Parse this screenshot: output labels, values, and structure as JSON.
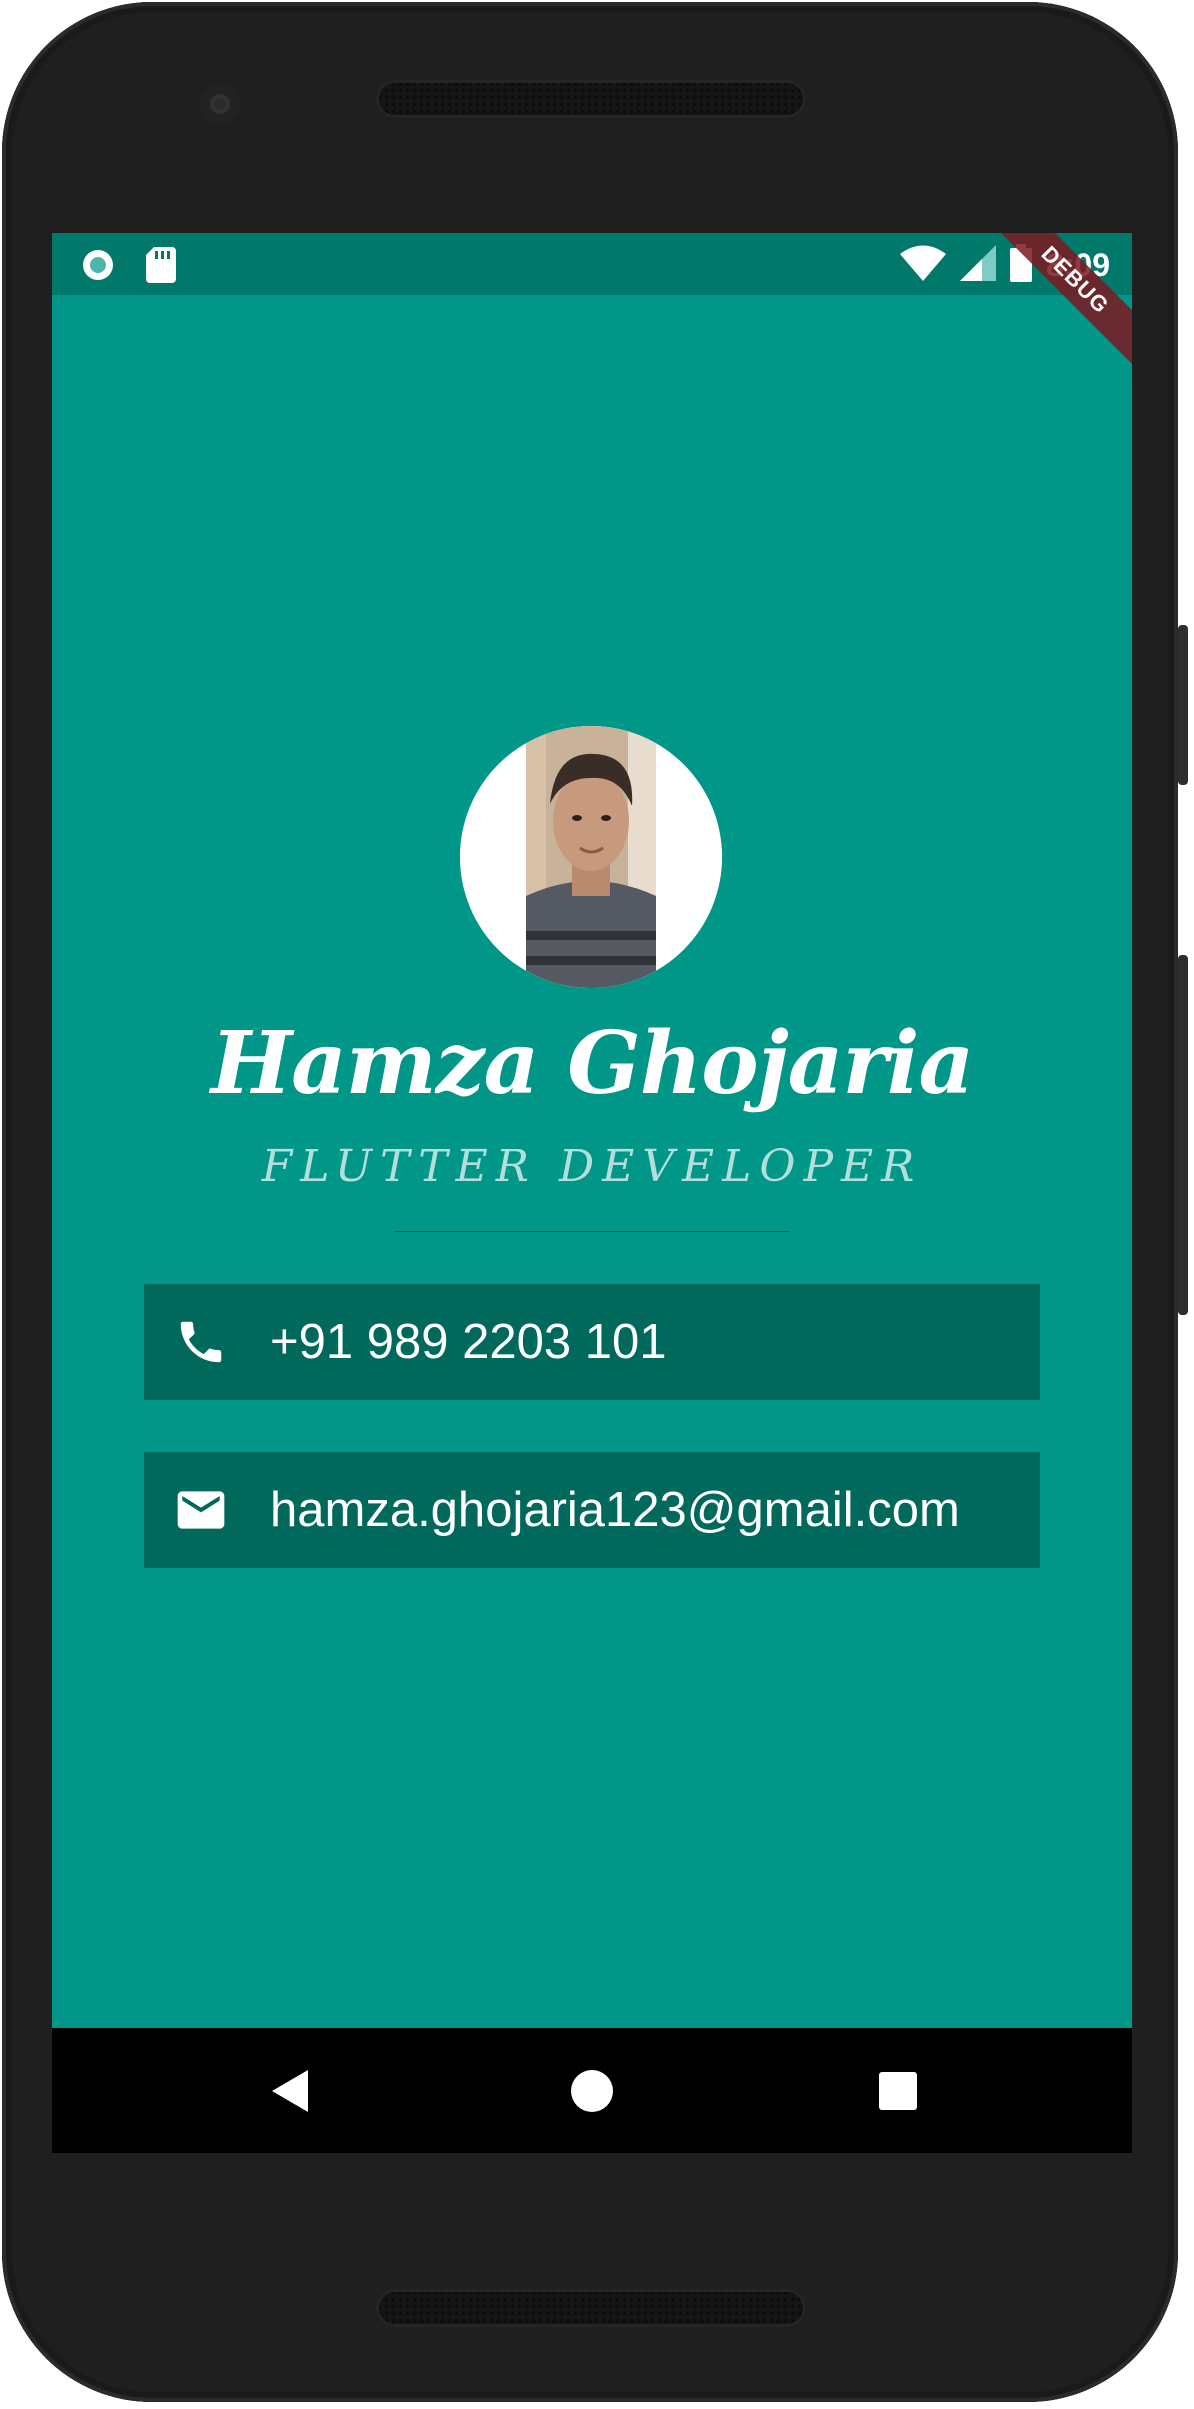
{
  "status_bar": {
    "time": "8:09",
    "left_icons": [
      "circle-status-icon",
      "sd-card-icon"
    ],
    "right_icons": [
      "wifi-icon",
      "cell-signal-icon",
      "battery-icon"
    ]
  },
  "debug_banner": "DEBUG",
  "profile": {
    "name": "Hamza Ghojaria",
    "role": "FLUTTER DEVELOPER"
  },
  "contacts": [
    {
      "icon": "phone-icon",
      "text": "+91 989 2203 101"
    },
    {
      "icon": "mail-icon",
      "text": "hamza.ghojaria123@gmail.com"
    }
  ],
  "nav_bar": [
    "back-icon",
    "home-icon",
    "recents-icon"
  ],
  "colors": {
    "background": "#009688",
    "status_bar": "#00796b",
    "card": "#00695c",
    "role_text": "#b2dfdb",
    "debug_ribbon": "#7e1721"
  }
}
